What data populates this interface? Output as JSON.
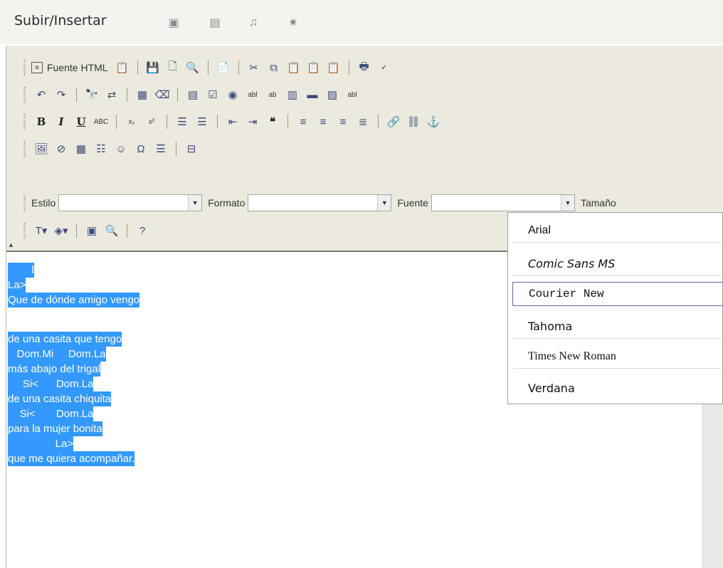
{
  "topbar": {
    "title": "Subir/Insertar",
    "icons": [
      "video-icon",
      "gallery-icon",
      "music-icon",
      "sparkle-icon"
    ]
  },
  "toolbar": {
    "source_label": "Fuente HTML",
    "row5": {
      "style_label": "Estilo",
      "style_value": "",
      "format_label": "Formato",
      "format_value": "",
      "font_label": "Fuente",
      "font_value": "",
      "size_label": "Tamaño"
    }
  },
  "content": {
    "lines": [
      "        l",
      "La>",
      "Que de dónde amigo vengo",
      "",
      "de una casita que tengo",
      "   Dom.Mi     Dom.La",
      "más abajo del trigal",
      "     Si<      Dom.La",
      "de una casita chiquita",
      "    Si<       Dom.La",
      "para la mujer bonita",
      "                La>",
      "que me quiera acompañar."
    ]
  },
  "font_dropdown": {
    "options": [
      "Arial",
      "Comic Sans MS",
      "Courier New",
      "Tahoma",
      "Times New Roman",
      "Verdana"
    ],
    "highlighted": "Courier New"
  }
}
